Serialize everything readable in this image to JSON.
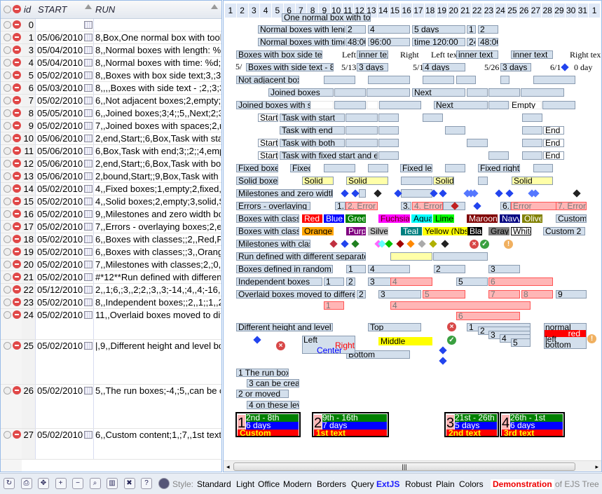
{
  "grid": {
    "headers": {
      "id": "id",
      "start": "START",
      "run": "RUN"
    },
    "rows": [
      {
        "id": "0",
        "start": "",
        "run": ""
      },
      {
        "id": "1",
        "start": "05/06/2010",
        "run": "8,Box,One normal box with toolti"
      },
      {
        "id": "3",
        "start": "05/04/2010",
        "run": "8,,Normal boxes with length: %n"
      },
      {
        "id": "4",
        "start": "05/04/2010",
        "run": "8,,Normal boxes with time: %d;;2"
      },
      {
        "id": "5",
        "start": "05/02/2010",
        "run": "8,,Boxes with box side text;3,;3,,in"
      },
      {
        "id": "6",
        "start": "05/03/2010",
        "run": "8,,,,Boxes with side text - ;2,;3;3,,"
      },
      {
        "id": "7",
        "start": "05/02/2010",
        "run": "6,,Not adjacent boxes;2,empty;3;"
      },
      {
        "id": "8",
        "start": "05/05/2010",
        "run": "6,,Joined boxes;3;4;;5,,Next;2;3;4"
      },
      {
        "id": "9",
        "start": "05/02/2010",
        "run": "7,,Joined boxes with spaces;2,nb"
      },
      {
        "id": "10",
        "start": "05/06/2010",
        "run": "2,end,Start;;6,Box,Task with start"
      },
      {
        "id": "11",
        "start": "05/06/2010",
        "run": "6,Box,Task with end;3;;2;;4,empty"
      },
      {
        "id": "12",
        "start": "05/06/2010",
        "run": "2,end,Start;;6,Box,Task with both"
      },
      {
        "id": "13",
        "start": "05/06/2010",
        "run": "2,bound,Start;;9,Box,Task with fix"
      },
      {
        "id": "14",
        "start": "05/02/2010",
        "run": "4,,Fixed boxes;1,empty;2,fixed,Fi"
      },
      {
        "id": "15",
        "start": "05/02/2010",
        "run": "4,,Solid boxes;2,empty;3,solid,So"
      },
      {
        "id": "16",
        "start": "05/02/2010",
        "run": "9,,Milestones and zero width box"
      },
      {
        "id": "17",
        "start": "05/02/2010",
        "run": "7,,Errors - overlaying boxes;2,em"
      },
      {
        "id": "18",
        "start": "05/02/2010",
        "run": "6,,Boxes with classes;;2,,Red,Re"
      },
      {
        "id": "19",
        "start": "05/02/2010",
        "run": "6,,Boxes with classes;;3,,Orange,"
      },
      {
        "id": "20",
        "start": "05/02/2010",
        "run": "7,,Milestones with classes;2,;0,m"
      },
      {
        "id": "21",
        "start": "05/02/2010",
        "run": "#*12**Run defined with different"
      },
      {
        "id": "22",
        "start": "05/12/2010",
        "run": "2,,1;6,;3,,2;2,;3,,3;-14,;4,,4;-16,;9,"
      },
      {
        "id": "23",
        "start": "05/02/2010",
        "run": "8,,Independent boxes;;2,,1;;1,,2;1"
      },
      {
        "id": "24",
        "start": "05/02/2010",
        "run": "11,,Overlaid boxes moved to diffe"
      },
      {
        "id": "25",
        "start": "05/02/2010",
        "run": "|,9,,Different height and level box"
      },
      {
        "id": "26",
        "start": "05/02/2010",
        "run": "5,,The run boxes;-4,;5,,can be cre"
      },
      {
        "id": "27",
        "start": "05/02/2010",
        "run": "6,,Custom content;1,;7,,1st text;5,"
      }
    ]
  },
  "gantt": {
    "days": [
      "1",
      "2",
      "3",
      "4",
      "5",
      "6",
      "7",
      "8",
      "9",
      "10",
      "11",
      "12",
      "13",
      "14",
      "15",
      "16",
      "17",
      "18",
      "19",
      "20",
      "21",
      "22",
      "23",
      "24",
      "25",
      "26",
      "27",
      "28",
      "29",
      "30",
      "31",
      "1"
    ],
    "labels": [
      "One normal box with to",
      "Normal boxes with leng",
      "2",
      "4",
      "5 days",
      "1",
      "Normal boxes with time",
      "48:00",
      "96:00",
      "time 120:00",
      "24",
      "Boxes with box side tex",
      "Left",
      "inner tex",
      "Right",
      "Left text",
      "inner text",
      "Right tex",
      "5/",
      "Boxes with side text - 8 days",
      "5/13",
      "3 days",
      "5/19",
      "4 days",
      "5/26",
      "6/1",
      "0 day",
      "Not adjacent box",
      "Joined boxes",
      "Next",
      "Joined boxes with s",
      "Empty",
      "Start",
      "Task with start",
      "Task with end",
      "End",
      "Task with both",
      "Task with fixed start and e",
      "Fixed boxes",
      "Fixed",
      "Fixed lef",
      "Fixed right",
      "Solid boxes",
      "Solid",
      "Milestones and zero width",
      "Errors - overlaying b",
      "1.",
      "2. Error",
      "3.",
      "4. Error",
      "6. E",
      "Error",
      "7. Error",
      "Boxes with class",
      "Red",
      "Blue",
      "Gree",
      "Fuchsia",
      "Aqua",
      "Lime",
      "Maroon",
      "Navy",
      "Olive",
      "Custom",
      "Orange",
      "Purpl",
      "Silver",
      "Teal",
      "Yellow (Nbsp",
      "Black",
      "Gray",
      "White",
      "Custom 2",
      "Milestones with clas",
      "Run defined with different separato",
      "Boxes defined in random",
      "3",
      "Independent boxes",
      "5",
      "6",
      "Overlaid boxes moved to differen",
      "7",
      "8",
      "9",
      "Different height and level",
      "Top",
      "normal",
      "red",
      "left",
      "bottom",
      "Center",
      "Middle",
      "Bottom",
      "1 The run box",
      "3 can be creat",
      "2 or moved",
      "4 on these lev"
    ],
    "custom_boxes": [
      {
        "num": "1",
        "line1": "2nd - 8th",
        "line2": "6 days",
        "line3": "Custom content"
      },
      {
        "num": "2",
        "line1": "9th - 16th",
        "line2": "7 days",
        "line3": "1st text"
      },
      {
        "num": "3",
        "line1": "21st - 26th",
        "line2": "5 days",
        "line3": "2nd text"
      },
      {
        "num": "4",
        "line1": "26th - 1st",
        "line2": "6 days",
        "line3": "3rd text"
      }
    ],
    "class_colors": {
      "Red": "#ff0000",
      "Blue": "#0000ff",
      "Green": "#008000",
      "Fuchsia": "#ff00ff",
      "Aqua": "#00ffff",
      "Lime": "#00ff00",
      "Maroon": "#800000",
      "Navy": "#000080",
      "Olive": "#808000",
      "Orange": "#ffa500",
      "Purple": "#800080",
      "Silver": "#c0c0c0",
      "Teal": "#008080",
      "Yellow": "#ffff00",
      "Black": "#000000",
      "Gray": "#808080",
      "White": "#ffffff"
    }
  },
  "toolbar": {
    "icons": [
      "refresh-icon",
      "print-icon",
      "move-icon",
      "zoom-in-icon",
      "zoom-out-icon",
      "zoom-fit-icon",
      "columns-icon",
      "tools-icon",
      "help-icon",
      "globe-icon"
    ],
    "help_glyph": "?",
    "style_label": "Style:",
    "styles": [
      "Standard",
      "Light",
      "Office",
      "Modern",
      "Borders",
      "Query",
      "ExtJS",
      "Robust",
      "Plain",
      "Colors"
    ],
    "selected_style": "ExtJS",
    "demo_label": "Demonstration",
    "demo_suffix": "of EJS Tree"
  }
}
